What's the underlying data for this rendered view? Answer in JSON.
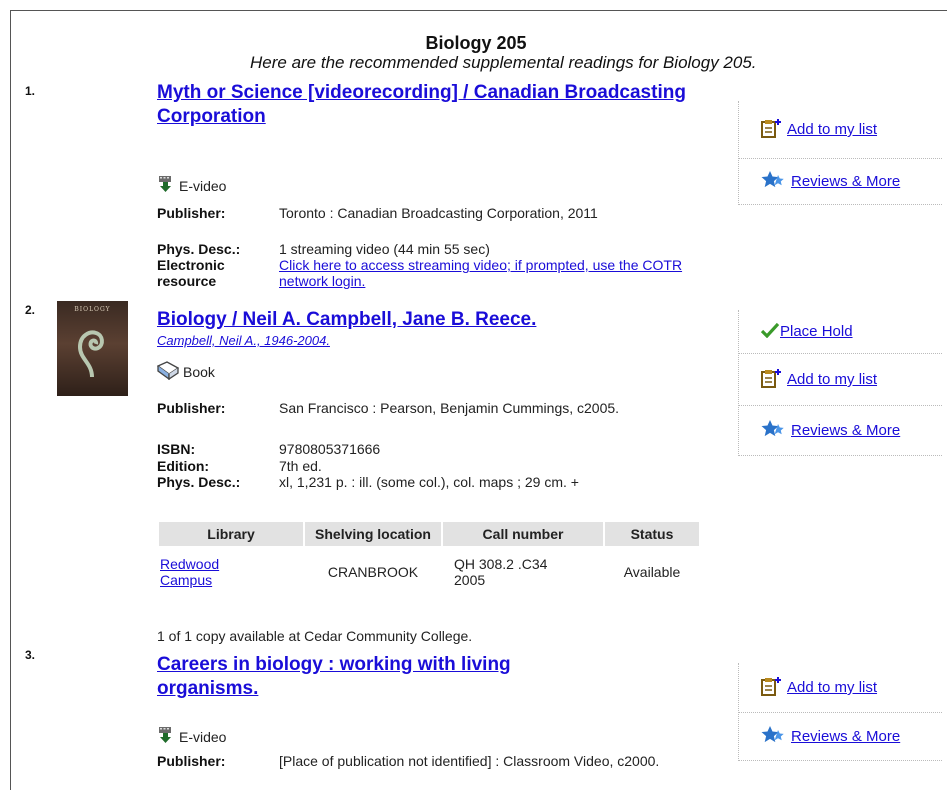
{
  "page": {
    "title": "Biology 205",
    "subtitle": "Here are the recommended supplemental readings for Biology 205."
  },
  "labels": {
    "publisher": "Publisher:",
    "phys_desc": "Phys. Desc.:",
    "electronic": "Electronic",
    "resource": "resource",
    "isbn": "ISBN:",
    "edition": "Edition:"
  },
  "records": [
    {
      "number": "1.",
      "title": "Myth or Science [videorecording] / Canadian Broadcasting Corporation",
      "format": "E-video",
      "format_icon": "download-video-icon",
      "publisher": "Toronto : Canadian Broadcasting Corporation, 2011",
      "phys_desc": "1 streaming video (44 min 55 sec)",
      "electronic_resource": "Click here to access streaming video; if prompted, use the COTR network login.",
      "actions": [
        "Add to my list",
        "Reviews & More"
      ]
    },
    {
      "number": "2.",
      "title": "Biology / Neil A. Campbell, Jane B. Reece.",
      "author": "Campbell, Neil A., 1946-2004.",
      "cover_text": "BIOLOGY",
      "format": "Book",
      "format_icon": "open-book-icon",
      "publisher": "San Francisco : Pearson, Benjamin Cummings, c2005.",
      "isbn": "9780805371666",
      "edition": "7th ed.",
      "phys_desc": "xl, 1,231 p. : ill. (some col.), col. maps ; 29 cm. +",
      "holdings": {
        "headers": [
          "Library",
          "Shelving location",
          "Call number",
          "Status"
        ],
        "rows": [
          {
            "library": "Redwood Campus",
            "location": "CRANBROOK",
            "call_number": "QH 308.2 .C34 2005",
            "status": "Available"
          }
        ]
      },
      "availability": "1 of 1 copy available at Cedar Community College.",
      "actions": [
        "Place Hold",
        "Add to my list",
        "Reviews & More"
      ]
    },
    {
      "number": "3.",
      "title": "Careers in biology : working with living organisms.",
      "format": "E-video",
      "format_icon": "download-video-icon",
      "publisher": "[Place of publication not identified] : Classroom Video, c2000.",
      "actions": [
        "Add to my list",
        "Reviews & More"
      ]
    }
  ]
}
